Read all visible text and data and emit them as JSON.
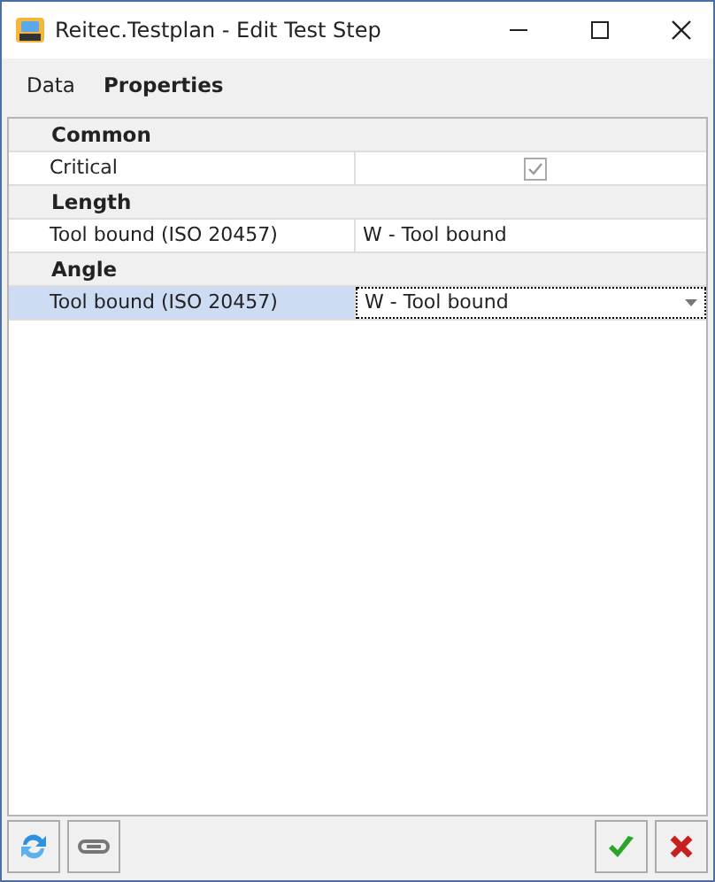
{
  "window": {
    "title": "Reitec.Testplan - Edit Test Step"
  },
  "tabs": [
    {
      "label": "Data",
      "selected": false
    },
    {
      "label": "Properties",
      "selected": true
    }
  ],
  "groups": [
    {
      "title": "Common",
      "rows": [
        {
          "label": "Critical",
          "kind": "checkbox",
          "checked": true,
          "selected": false
        }
      ]
    },
    {
      "title": "Length",
      "rows": [
        {
          "label": "Tool bound (ISO 20457)",
          "kind": "text",
          "value": "W - Tool bound",
          "selected": false
        }
      ]
    },
    {
      "title": "Angle",
      "rows": [
        {
          "label": "Tool bound (ISO 20457)",
          "kind": "dropdown",
          "value": "W - Tool bound",
          "selected": true
        }
      ]
    }
  ]
}
